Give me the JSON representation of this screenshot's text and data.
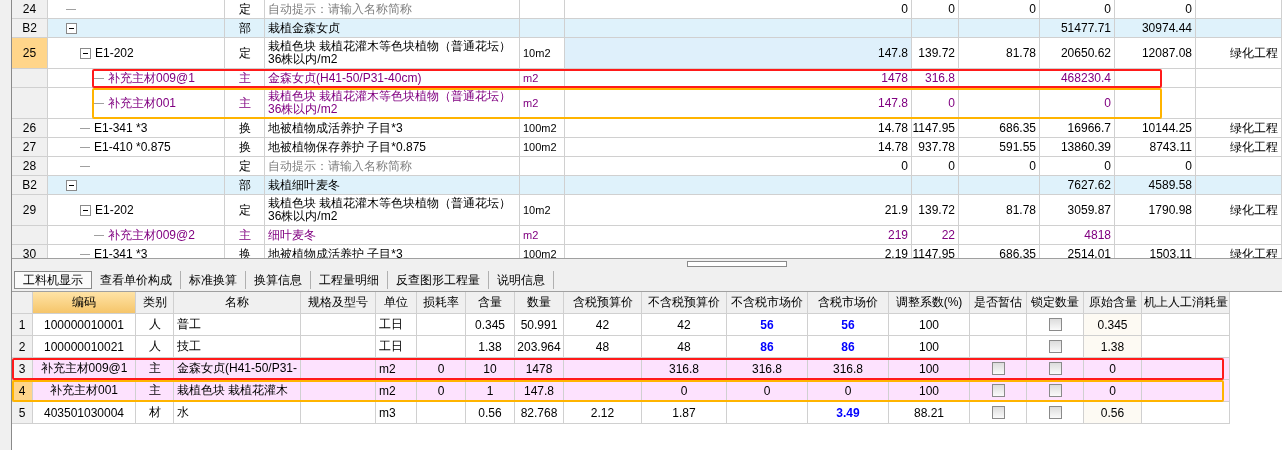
{
  "top_table": {
    "rows": [
      {
        "no": "24",
        "category": "定",
        "name": "自动提示：请输入名称简称",
        "kind": "placeholder",
        "selected": false,
        "values": {
          "column_6": "0",
          "column_7": "0",
          "column_8": "0",
          "column_9": "0",
          "column_10": "0"
        }
      },
      {
        "no": "B2",
        "category": "部",
        "name": "栽植金森女贞",
        "kind": "section",
        "selected": false,
        "expanded": true,
        "values": {
          "column_9": "51477.71",
          "column_10": "30974.44"
        },
        "children": [
          {
            "no": "25",
            "code": "E1-202",
            "category": "定",
            "name": "栽植色块 栽植花灌木等色块植物（普通花坛）36株以内/m2",
            "unit": "10m2",
            "kind": "item",
            "selected": true,
            "expanded": true,
            "values": {
              "column_6": "147.8",
              "column_7": "139.72",
              "column_8": "81.78",
              "column_9": "20650.62",
              "column_10": "12087.08"
            },
            "project": "绿化工程",
            "children": [
              {
                "code": "补充主材009@1",
                "category": "主",
                "name": "金森女贞(H41-50/P31-40cm)",
                "unit": "m2",
                "kind": "material",
                "selected": false,
                "values": {
                  "column_6": "1478",
                  "column_7": "316.8",
                  "column_9": "468230.4"
                },
                "color": "#ff1a1a"
              },
              {
                "code": "补充主材001",
                "category": "主",
                "name": "栽植色块 栽植花灌木等色块植物（普通花坛）36株以内/m2",
                "unit": "m2",
                "kind": "material",
                "selected": false,
                "values": {
                  "column_6": "147.8",
                  "column_7": "0",
                  "column_9": "0"
                },
                "color": "#ffb400"
              }
            ]
          },
          {
            "no": "26",
            "code": "E1-341 *3",
            "category": "换",
            "name": "地被植物成活养护 子目*3",
            "unit": "100m2",
            "kind": "item",
            "selected": false,
            "values": {
              "column_6": "14.78",
              "column_7": "1147.95",
              "column_8": "686.35",
              "column_9": "16966.7",
              "column_10": "10144.25"
            },
            "project": "绿化工程"
          },
          {
            "no": "27",
            "code": "E1-410 *0.875",
            "category": "换",
            "name": "地被植物保存养护 子目*0.875",
            "unit": "100m2",
            "kind": "item",
            "selected": false,
            "values": {
              "column_6": "14.78",
              "column_7": "937.78",
              "column_8": "591.55",
              "column_9": "13860.39",
              "column_10": "8743.11"
            },
            "project": "绿化工程"
          },
          {
            "no": "28",
            "category": "定",
            "name": "自动提示：请输入名称简称",
            "kind": "placeholder",
            "selected": false,
            "values": {
              "column_6": "0",
              "column_7": "0",
              "column_8": "0",
              "column_9": "0",
              "column_10": "0"
            }
          }
        ]
      },
      {
        "no": "B2",
        "category": "部",
        "name": "栽植细叶麦冬",
        "kind": "section",
        "selected": false,
        "expanded": true,
        "values": {
          "column_9": "7627.62",
          "column_10": "4589.58"
        },
        "children": [
          {
            "no": "29",
            "code": "E1-202",
            "category": "定",
            "name": "栽植色块 栽植花灌木等色块植物（普通花坛）36株以内/m2",
            "unit": "10m2",
            "kind": "item",
            "selected": false,
            "expanded": true,
            "values": {
              "column_6": "21.9",
              "column_7": "139.72",
              "column_8": "81.78",
              "column_9": "3059.87",
              "column_10": "1790.98"
            },
            "project": "绿化工程",
            "children": [
              {
                "code": "补充主材009@2",
                "category": "主",
                "name": "细叶麦冬",
                "unit": "m2",
                "kind": "material",
                "selected": false,
                "values": {
                  "column_6": "219",
                  "column_7": "22",
                  "column_9": "4818"
                }
              }
            ]
          },
          {
            "no": "30",
            "code": "E1-341 *3",
            "category": "换",
            "name": "地被植物成活养护 子目*3",
            "unit": "100m2",
            "kind": "item",
            "selected": false,
            "values": {
              "column_6": "2.19",
              "column_7": "1147.95",
              "column_8": "686.35",
              "column_9": "2514.01",
              "column_10": "1503.11"
            },
            "project": "绿化工程"
          }
        ]
      }
    ]
  },
  "tabs": [
    {
      "label": "工料机显示",
      "selected": true
    },
    {
      "label": "查看单价构成",
      "selected": false
    },
    {
      "label": "标准换算",
      "selected": false
    },
    {
      "label": "换算信息",
      "selected": false
    },
    {
      "label": "工程量明细",
      "selected": false
    },
    {
      "label": "反查图形工程量",
      "selected": false
    },
    {
      "label": "说明信息",
      "selected": false
    }
  ],
  "resource_table": {
    "columns": [
      {
        "label": "编码",
        "selected": true
      },
      {
        "label": "类别",
        "selected": false
      },
      {
        "label": "名称",
        "selected": false
      },
      {
        "label": "规格及型号",
        "selected": false
      },
      {
        "label": "单位",
        "selected": false
      },
      {
        "label": "损耗率",
        "selected": false
      },
      {
        "label": "含量",
        "selected": false
      },
      {
        "label": "数量",
        "selected": false
      },
      {
        "label": "含税预算价",
        "selected": false
      },
      {
        "label": "不含税预算价",
        "selected": false
      },
      {
        "label": "不含税市场价",
        "selected": false
      },
      {
        "label": "含税市场价",
        "selected": false
      },
      {
        "label": "调整系数(%)",
        "selected": false
      },
      {
        "label": "是否暂估",
        "selected": false
      },
      {
        "label": "锁定数量",
        "selected": false
      },
      {
        "label": "原始含量",
        "selected": false
      },
      {
        "label": "机上人工消耗量",
        "selected": false
      }
    ],
    "rows": [
      {
        "no": "1",
        "kind": "labor",
        "selected": false,
        "market_modified": true,
        "cells": {
          "code": "100000010001",
          "category": "人",
          "name": "普工",
          "unit": "工日",
          "content": "0.345",
          "quantity": "50.991",
          "tax_budget_price": "42",
          "budget_price": "42",
          "market_price": "56",
          "tax_market_price": "56",
          "factor": "100"
        },
        "locked": {
          "checked": false
        },
        "original": "0.345"
      },
      {
        "no": "2",
        "kind": "labor",
        "selected": false,
        "market_modified": true,
        "cells": {
          "code": "100000010021",
          "category": "人",
          "name": "技工",
          "unit": "工日",
          "content": "1.38",
          "quantity": "203.964",
          "tax_budget_price": "48",
          "budget_price": "48",
          "market_price": "86",
          "tax_market_price": "86",
          "factor": "100"
        },
        "locked": {
          "checked": false
        },
        "original": "1.38"
      },
      {
        "no": "3",
        "kind": "material",
        "selected": false,
        "market_modified": false,
        "cells": {
          "code": "补充主材009@1",
          "category": "主",
          "name": "金森女贞(H41-50/P31-",
          "unit": "m2",
          "loss_rate": "0",
          "content": "10",
          "quantity": "1478",
          "budget_price": "316.8",
          "market_price": "316.8",
          "tax_market_price": "316.8",
          "factor": "100"
        },
        "provisional": {
          "checked": false
        },
        "locked": {
          "checked": false
        },
        "original": "0",
        "color": "#ff1a1a"
      },
      {
        "no": "4",
        "kind": "material",
        "selected": true,
        "market_modified": false,
        "cells": {
          "code": "补充主材001",
          "category": "主",
          "name": "栽植色块 栽植花灌木",
          "unit": "m2",
          "loss_rate": "0",
          "content": "1",
          "quantity": "147.8",
          "budget_price": "0",
          "market_price": "0",
          "tax_market_price": "0",
          "factor": "100"
        },
        "provisional": {
          "checked": false
        },
        "locked": {
          "checked": false
        },
        "original": "0",
        "color": "#ffb400"
      },
      {
        "no": "5",
        "kind": "other",
        "selected": false,
        "market_modified": true,
        "cells": {
          "code": "403501030004",
          "category": "材",
          "name": "水",
          "unit": "m3",
          "content": "0.56",
          "quantity": "82.768",
          "tax_budget_price": "2.12",
          "budget_price": "1.87",
          "tax_market_price": "3.49",
          "factor": "88.21"
        },
        "provisional": {
          "checked": false
        },
        "locked": {
          "checked": false
        },
        "original": "0.56"
      }
    ]
  }
}
